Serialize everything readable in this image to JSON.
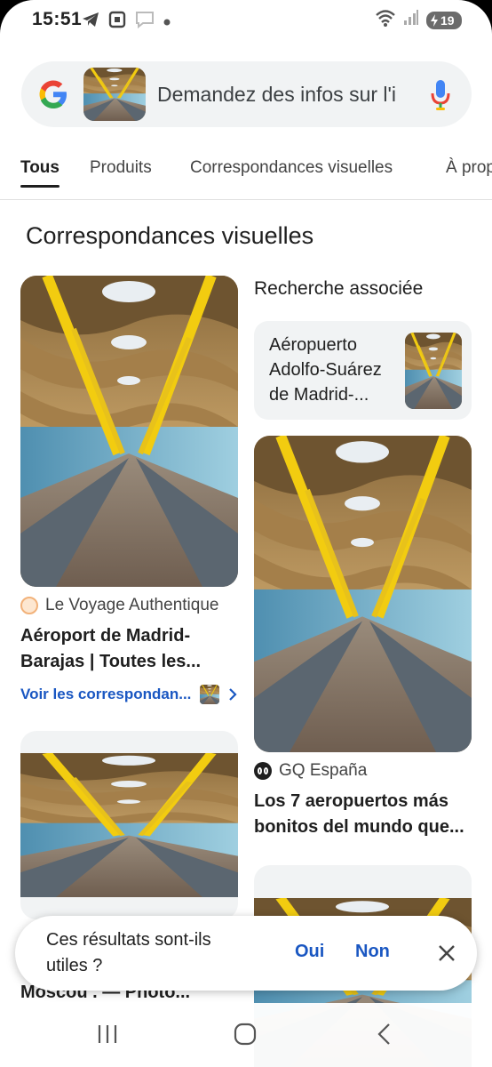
{
  "status_bar": {
    "time": "15:51",
    "battery": "19",
    "icons": [
      "telegram-icon",
      "screenshot-icon",
      "message-icon",
      "dot-icon",
      "wifi-icon",
      "signal-icon",
      "battery-icon"
    ]
  },
  "search": {
    "placeholder": "Demandez des infos sur l'i"
  },
  "tabs": [
    {
      "label": "Tous",
      "active": true
    },
    {
      "label": "Produits",
      "active": false
    },
    {
      "label": "Correspondances visuelles",
      "active": false
    },
    {
      "label": "À prop",
      "active": false
    }
  ],
  "section_title": "Correspondances visuelles",
  "related": {
    "title": "Recherche associée",
    "card_label": "Aéropuerto Adolfo-Suárez de Madrid-..."
  },
  "results": [
    {
      "source": "Le Voyage Authentique",
      "title_line1": "Aéroport de Madrid-",
      "title_line2": "Barajas | Toutes les...",
      "see_more": "Voir les correspondan..."
    },
    {
      "source": "GQ España",
      "title_line1": "Los 7 aeropuertos más",
      "title_line2": "bonitos del mundo que..."
    },
    {
      "partial_title": "Moscou . — Photo..."
    }
  ],
  "feedback": {
    "question": "Ces résultats sont-ils utiles ?",
    "yes": "Oui",
    "no": "Non"
  },
  "colors": {
    "accent": "#1a57c2",
    "wood": "#b98a4e",
    "beam": "#e8c21a",
    "surface": "#f1f3f4"
  }
}
